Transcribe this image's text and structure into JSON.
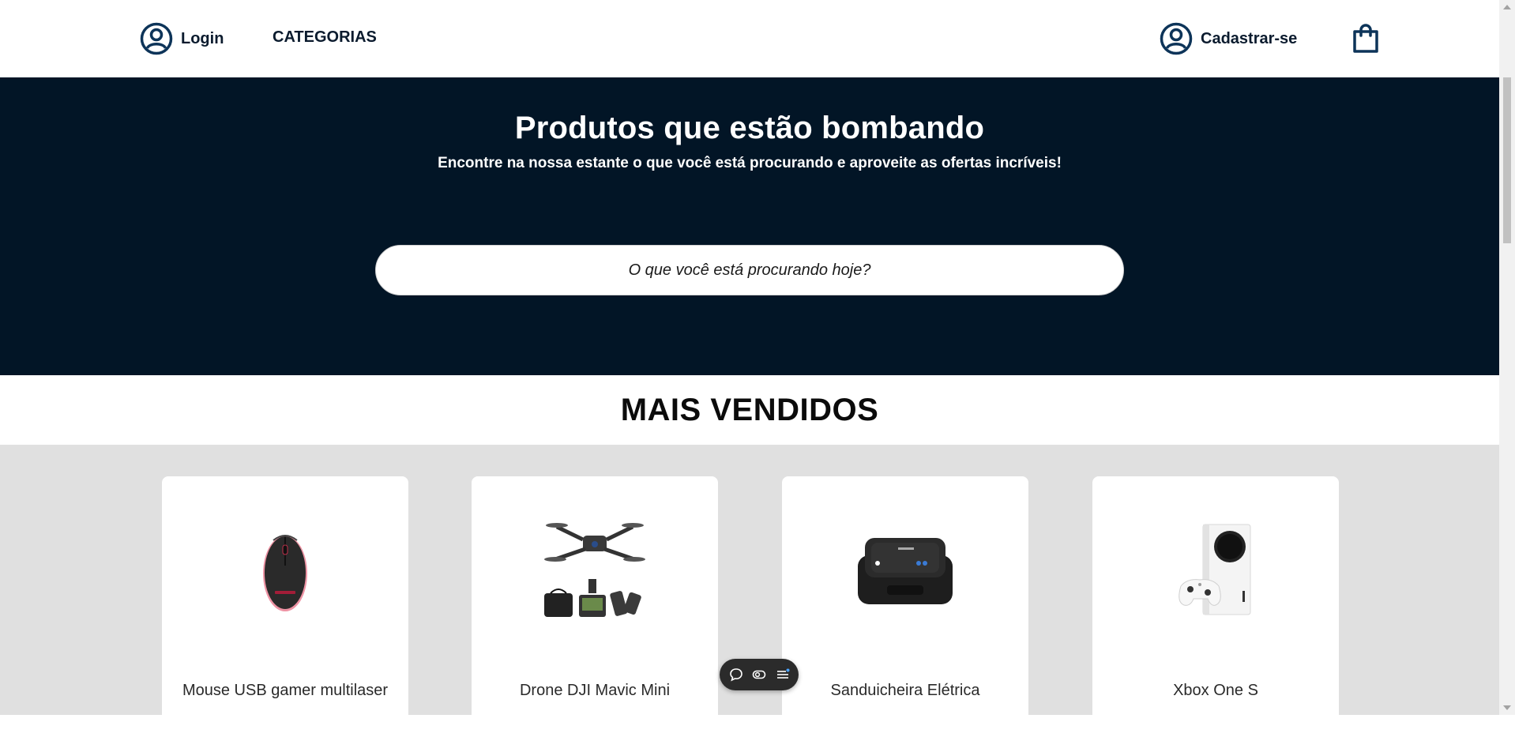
{
  "header": {
    "login_label": "Login",
    "categories_label": "CATEGORIAS",
    "signup_label": "Cadastrar-se"
  },
  "hero": {
    "title": "Produtos que estão bombando",
    "subtitle": "Encontre na nossa estante o que você está procurando e aproveite as ofertas incríveis!",
    "search_placeholder": "O que você está procurando hoje?"
  },
  "section": {
    "title": "MAIS VENDIDOS"
  },
  "products": [
    {
      "name": "Mouse USB gamer multilaser",
      "icon": "mouse-image"
    },
    {
      "name": "Drone DJI Mavic Mini",
      "icon": "drone-image"
    },
    {
      "name": "Sanduicheira Elétrica",
      "icon": "sandwich-maker-image"
    },
    {
      "name": "Xbox One S",
      "icon": "xbox-image"
    }
  ],
  "colors": {
    "hero_bg": "#021526",
    "nav_text": "#0b1b2e",
    "icon_blue": "#0d3459",
    "products_bg": "#e0e0e0"
  }
}
